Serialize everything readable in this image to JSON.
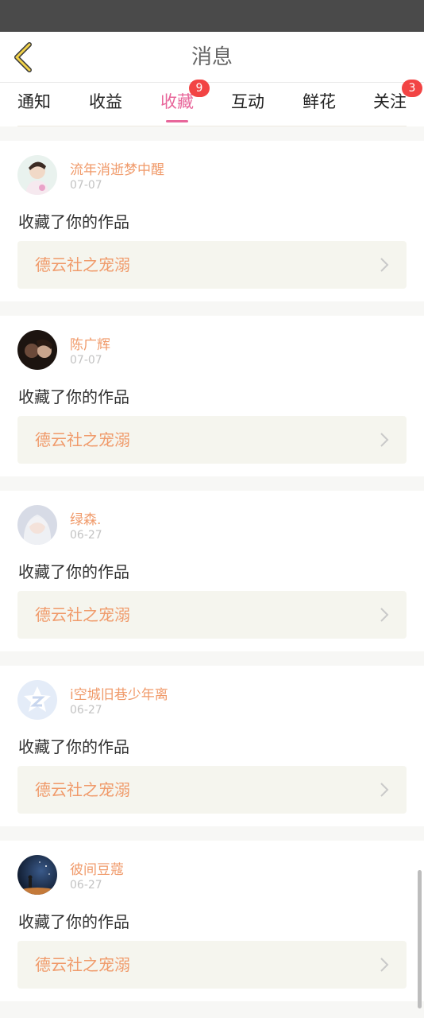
{
  "header": {
    "title": "消息"
  },
  "tabs": [
    {
      "label": "通知",
      "badge": ""
    },
    {
      "label": "收益",
      "badge": ""
    },
    {
      "label": "收藏",
      "badge": "9",
      "active": true
    },
    {
      "label": "互动",
      "badge": ""
    },
    {
      "label": "鲜花",
      "badge": ""
    },
    {
      "label": "关注",
      "badge": "3"
    }
  ],
  "notifications": [
    {
      "name": "流年消逝梦中醒",
      "date": "07-07",
      "action": "收藏了你的作品",
      "work": "德云社之宠溺",
      "avatar": "avatar-1"
    },
    {
      "name": "陈广辉",
      "date": "07-07",
      "action": "收藏了你的作品",
      "work": "德云社之宠溺",
      "avatar": "avatar-2"
    },
    {
      "name": "绿森.",
      "date": "06-27",
      "action": "收藏了你的作品",
      "work": "德云社之宠溺",
      "avatar": "avatar-3"
    },
    {
      "name": "i空城旧巷少年离",
      "date": "06-27",
      "action": "收藏了你的作品",
      "work": "德云社之宠溺",
      "avatar": "default-avatar"
    },
    {
      "name": "彼间豆蔻",
      "date": "06-27",
      "action": "收藏了你的作品",
      "work": "德云社之宠溺",
      "avatar": "avatar-5"
    }
  ],
  "colors": {
    "accent": "#e8669a",
    "name": "#f09a6a",
    "badge": "#f24444",
    "status_bar": "#4a4a4a"
  }
}
